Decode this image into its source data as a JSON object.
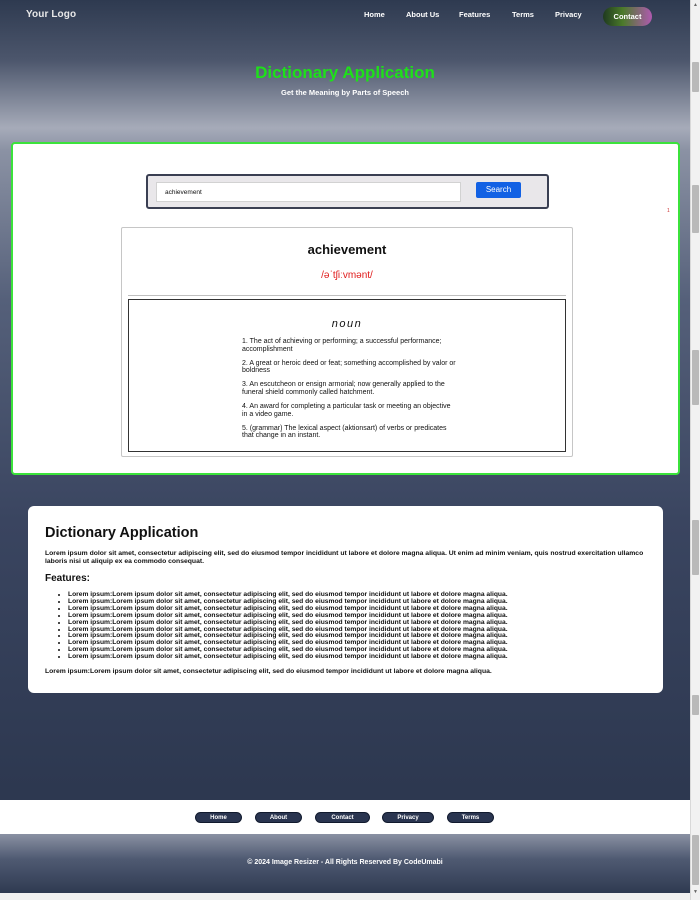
{
  "header": {
    "logo": "Your Logo",
    "nav": [
      "Home",
      "About Us",
      "Features",
      "Terms",
      "Privacy"
    ],
    "contact_label": "Contact"
  },
  "hero": {
    "title": "Dictionary Application",
    "subtitle": "Get the Meaning by Parts of Speech"
  },
  "search": {
    "value": "achievement",
    "button_label": "Search"
  },
  "result": {
    "word": "achievement",
    "phonetic": "/əˈtʃiːvmənt/",
    "part_of_speech": "noun",
    "definitions": [
      "1. The act of achieving or performing; a successful performance; accomplishment",
      "2. A great or heroic deed or feat; something accomplished by valor or boldness",
      "3. An escutcheon or ensign armorial; now generally applied to the funeral shield commonly called hatchment.",
      "4. An award for completing a particular task or meeting an objective in a video game.",
      "5. (grammar) The lexical aspect (aktionsart) of verbs or predicates that change in an instant."
    ]
  },
  "marker": "1",
  "about": {
    "title": "Dictionary Application",
    "text": "Lorem ipsum dolor sit amet, consectetur adipiscing elit, sed do eiusmod tempor incididunt ut labore et dolore magna aliqua. Ut enim ad minim veniam, quis nostrud exercitation ullamco laboris nisi ut aliquip ex ea commodo consequat.",
    "features_title": "Features:",
    "features": [
      "Lorem ipsum:Lorem ipsum dolor sit amet, consectetur adipiscing elit, sed do eiusmod tempor incididunt ut labore et dolore magna aliqua.",
      "Lorem ipsum:Lorem ipsum dolor sit amet, consectetur adipiscing elit, sed do eiusmod tempor incididunt ut labore et dolore magna aliqua.",
      "Lorem ipsum:Lorem ipsum dolor sit amet, consectetur adipiscing elit, sed do eiusmod tempor incididunt ut labore et dolore magna aliqua.",
      "Lorem ipsum:Lorem ipsum dolor sit amet, consectetur adipiscing elit, sed do eiusmod tempor incididunt ut labore et dolore magna aliqua.",
      "Lorem ipsum:Lorem ipsum dolor sit amet, consectetur adipiscing elit, sed do eiusmod tempor incididunt ut labore et dolore magna aliqua.",
      "Lorem ipsum:Lorem ipsum dolor sit amet, consectetur adipiscing elit, sed do eiusmod tempor incididunt ut labore et dolore magna aliqua.",
      "Lorem ipsum:Lorem ipsum dolor sit amet, consectetur adipiscing elit, sed do eiusmod tempor incididunt ut labore et dolore magna aliqua.",
      "Lorem ipsum:Lorem ipsum dolor sit amet, consectetur adipiscing elit, sed do eiusmod tempor incididunt ut labore et dolore magna aliqua.",
      "Lorem ipsum:Lorem ipsum dolor sit amet, consectetur adipiscing elit, sed do eiusmod tempor incididunt ut labore et dolore magna aliqua.",
      "Lorem ipsum:Lorem ipsum dolor sit amet, consectetur adipiscing elit, sed do eiusmod tempor incididunt ut labore et dolore magna aliqua."
    ],
    "footer_text": "Lorem ipsum:Lorem ipsum dolor sit amet, consectetur adipiscing elit, sed do eiusmod tempor incididunt ut labore et dolore magna aliqua."
  },
  "footer": {
    "links": [
      "Home",
      "About",
      "Contact",
      "Privacy",
      "Terms"
    ],
    "copyright": "© 2024 Image Resizer - All Rights Reserved By CodeUmabi"
  },
  "colors": {
    "title_green": "#1ee01a",
    "card_border": "#3be23b",
    "search_button": "#1261e4",
    "phonetic_red": "#e01b1b",
    "footer_pill": "#2a3550"
  }
}
